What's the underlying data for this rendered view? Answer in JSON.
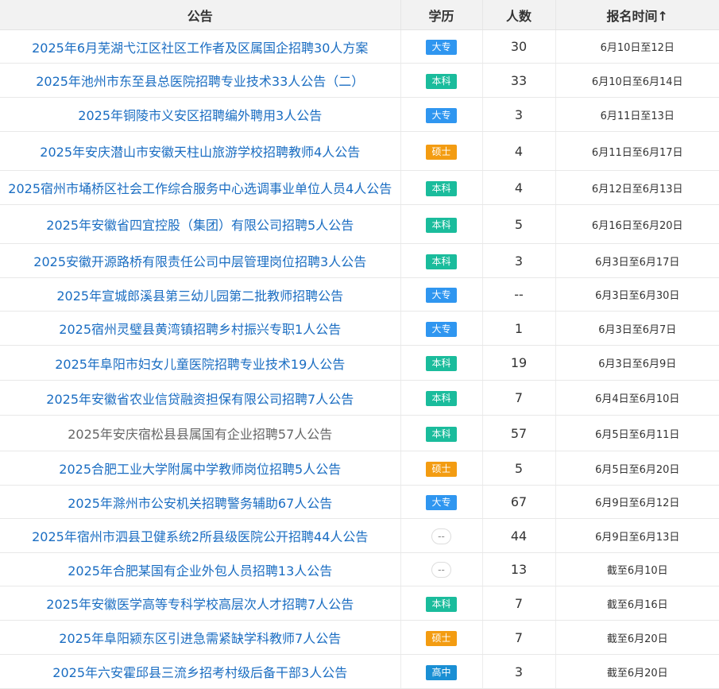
{
  "headers": {
    "title": "公告",
    "education": "学历",
    "count": "人数",
    "date": "报名时间",
    "sort_arrow": "↑"
  },
  "badge_colors": {
    "大专": "#2f96f0",
    "本科": "#1abc9c",
    "硕士": "#f39c12",
    "高中": "#1a8fd4"
  },
  "rows": [
    {
      "title": "2025年6月芜湖弋江区社区工作者及区属国企招聘30人方案",
      "edu": "大专",
      "count": "30",
      "date": "6月10日至12日",
      "h": 42,
      "visited": false
    },
    {
      "title": "2025年池州市东至县总医院招聘专业技术33人公告（二）",
      "edu": "本科",
      "count": "33",
      "date": "6月10日至6月14日",
      "h": 43,
      "visited": false
    },
    {
      "title": "2025年铜陵市义安区招聘编外聘用3人公告",
      "edu": "大专",
      "count": "3",
      "date": "6月11日至13日",
      "h": 43,
      "visited": false
    },
    {
      "title": "2025年安庆潜山市安徽天柱山旅游学校招聘教师4人公告",
      "edu": "硕士",
      "count": "4",
      "date": "6月11日至6月17日",
      "h": 49,
      "visited": false
    },
    {
      "title": "2025宿州市埇桥区社会工作综合服务中心选调事业单位人员4人公告",
      "edu": "本科",
      "count": "4",
      "date": "6月12日至6月13日",
      "h": 43,
      "visited": false
    },
    {
      "title": "2025年安徽省四宜控股（集团）有限公司招聘5人公告",
      "edu": "本科",
      "count": "5",
      "date": "6月16日至6月20日",
      "h": 49,
      "visited": false
    },
    {
      "title": "2025安徽开源路桥有限责任公司中层管理岗位招聘3人公告",
      "edu": "本科",
      "count": "3",
      "date": "6月3日至6月17日",
      "h": 43,
      "visited": false
    },
    {
      "title": "2025年宣城郎溪县第三幼儿园第二批教师招聘公告",
      "edu": "大专",
      "count": "--",
      "date": "6月3日至6月30日",
      "h": 42,
      "visited": false
    },
    {
      "title": "2025宿州灵璧县黄湾镇招聘乡村振兴专职1人公告",
      "edu": "大专",
      "count": "1",
      "date": "6月3日至6月7日",
      "h": 43,
      "visited": false
    },
    {
      "title": "2025年阜阳市妇女儿童医院招聘专业技术19人公告",
      "edu": "本科",
      "count": "19",
      "date": "6月3日至6月9日",
      "h": 44,
      "visited": false
    },
    {
      "title": "2025年安徽省农业信贷融资担保有限公司招聘7人公告",
      "edu": "本科",
      "count": "7",
      "date": "6月4日至6月10日",
      "h": 44,
      "visited": false
    },
    {
      "title": "2025年安庆宿松县县属国有企业招聘57人公告",
      "edu": "本科",
      "count": "57",
      "date": "6月5日至6月11日",
      "h": 45,
      "visited": true
    },
    {
      "title": "2025合肥工业大学附属中学教师岗位招聘5人公告",
      "edu": "硕士",
      "count": "5",
      "date": "6月5日至6月20日",
      "h": 43,
      "visited": false
    },
    {
      "title": "2025年滁州市公安机关招聘警务辅助67人公告",
      "edu": "大专",
      "count": "67",
      "date": "6月9日至6月12日",
      "h": 42,
      "visited": false
    },
    {
      "title": "2025年宿州市泗县卫健系统2所县级医院公开招聘44人公告",
      "edu": "--",
      "count": "44",
      "date": "6月9日至6月13日",
      "h": 43,
      "visited": false
    },
    {
      "title": "2025年合肥某国有企业外包人员招聘13人公告",
      "edu": "--",
      "count": "13",
      "date": "截至6月10日",
      "h": 42,
      "visited": false
    },
    {
      "title": "2025年安徽医学高等专科学校高层次人才招聘7人公告",
      "edu": "本科",
      "count": "7",
      "date": "截至6月16日",
      "h": 43,
      "visited": false
    },
    {
      "title": "2025年阜阳颍东区引进急需紧缺学科教师7人公告",
      "edu": "硕士",
      "count": "7",
      "date": "截至6月20日",
      "h": 43,
      "visited": false
    },
    {
      "title": "2025年六安霍邱县三流乡招考村级后备干部3人公告",
      "edu": "高中",
      "count": "3",
      "date": "截至6月20日",
      "h": 43,
      "visited": false
    }
  ]
}
